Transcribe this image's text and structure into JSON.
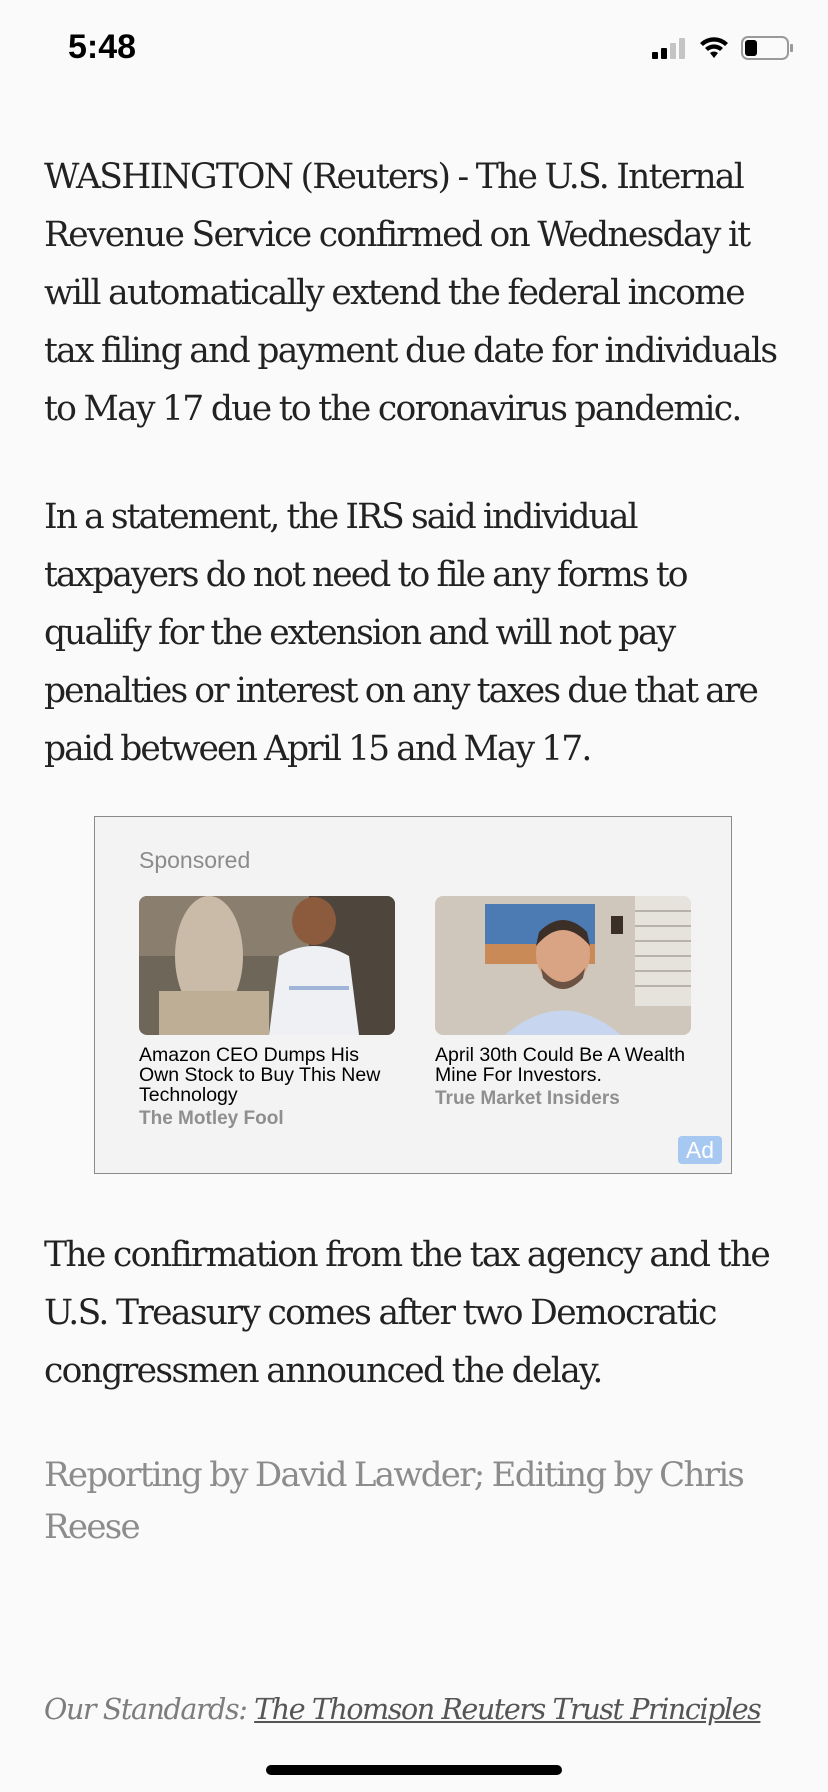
{
  "status_bar": {
    "time": "5:48",
    "signal_icon": "cellular-signal-icon",
    "wifi_icon": "wifi-icon",
    "battery_icon": "battery-low-icon",
    "signal_bars_active": 2,
    "signal_bars_total": 4,
    "battery_level": 0.25
  },
  "article": {
    "paragraph_1": "WASHINGTON (Reuters) - The U.S. Internal Revenue Service confirmed on Wednesday it will automatically extend the federal income tax filing and payment due date for individuals to May 17 due to the coronavirus pandemic.",
    "paragraph_2": "In a statement, the IRS said individual taxpayers do not need to file any forms to qualify for the extension and will not pay penalties or interest on any taxes due that are paid between April 15 and May 17.",
    "paragraph_3": "The confirmation from the tax agency and the U.S. Treasury comes after two Democratic congressmen announced the delay.",
    "byline": "Reporting by David Lawder; Editing by Chris Reese",
    "standards_label": "Our Standards:",
    "standards_link": "The Thomson Reuters Trust Principles"
  },
  "ad": {
    "sponsored_label": "Sponsored",
    "badge": "Ad",
    "items": [
      {
        "headline": "Amazon CEO Dumps His Own Stock to Buy This New Technology",
        "source": "The Motley Fool"
      },
      {
        "headline": "April 30th Could Be A Wealth Mine For Investors.",
        "source": "True Market Insiders"
      }
    ]
  },
  "colors": {
    "background": "#fafafa",
    "text": "#222222",
    "muted": "#8c8c8c",
    "ad_badge": "#a6c8f1"
  }
}
